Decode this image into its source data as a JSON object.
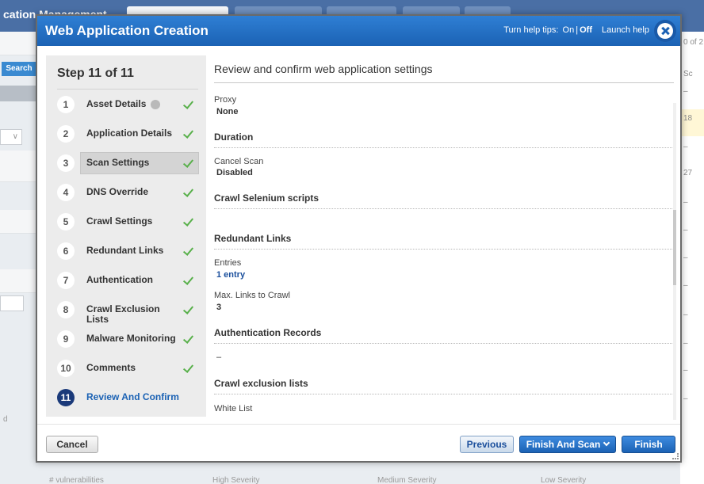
{
  "background": {
    "title": "cation Management",
    "search_label": "Search",
    "right_labels": [
      "0 of 2",
      "Sc",
      "–",
      "18",
      "–",
      "27",
      "–",
      "–",
      "–",
      "–",
      "–",
      "–",
      "–",
      "–"
    ],
    "left_letter": "d",
    "footer_cols": [
      "# vulnerabilities",
      "High Severity",
      "Medium Severity",
      "Low Severity"
    ]
  },
  "modal": {
    "title": "Web Application Creation",
    "help_tips_label": "Turn help tips:",
    "help_on": "On",
    "help_sep": "|",
    "help_off": "Off",
    "launch_help": "Launch help"
  },
  "sidebar": {
    "step_heading": "Step 11 of 11",
    "steps": [
      {
        "num": "1",
        "label": "Asset Details",
        "done": true
      },
      {
        "num": "2",
        "label": "Application Details",
        "done": true
      },
      {
        "num": "3",
        "label": "Scan Settings",
        "done": true
      },
      {
        "num": "4",
        "label": "DNS Override",
        "done": true
      },
      {
        "num": "5",
        "label": "Crawl Settings",
        "done": true
      },
      {
        "num": "6",
        "label": "Redundant Links",
        "done": true
      },
      {
        "num": "7",
        "label": "Authentication",
        "done": true
      },
      {
        "num": "8",
        "label": "Crawl Exclusion Lists",
        "done": true
      },
      {
        "num": "9",
        "label": "Malware Monitoring",
        "done": true
      },
      {
        "num": "10",
        "label": "Comments",
        "done": true
      },
      {
        "num": "11",
        "label": "Review And Confirm",
        "done": false
      }
    ]
  },
  "content": {
    "title": "Review and confirm web application settings",
    "proxy_label": "Proxy",
    "proxy_value": "None",
    "duration_heading": "Duration",
    "cancel_scan_label": "Cancel Scan",
    "cancel_scan_value": "Disabled",
    "selenium_heading": "Crawl Selenium scripts",
    "redundant_heading": "Redundant Links",
    "entries_label": "Entries",
    "entries_value": "1 entry",
    "max_links_label": "Max. Links to Crawl",
    "max_links_value": "3",
    "auth_heading": "Authentication Records",
    "auth_value": "–",
    "exclusion_heading": "Crawl exclusion lists",
    "white_list_label": "White List"
  },
  "footer": {
    "cancel": "Cancel",
    "previous": "Previous",
    "finish_and_scan": "Finish And Scan",
    "finish": "Finish"
  }
}
